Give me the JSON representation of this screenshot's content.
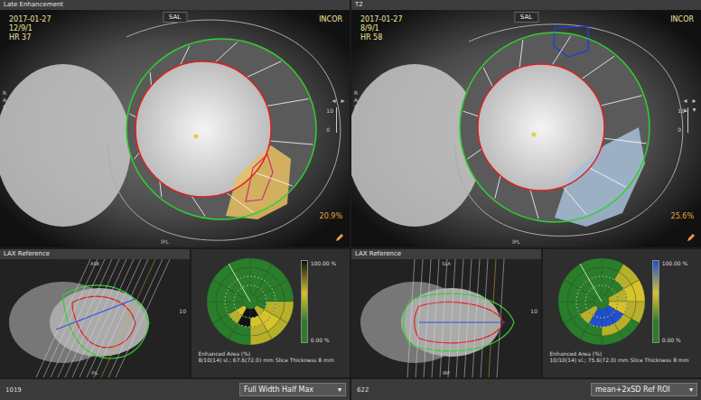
{
  "panels": [
    {
      "title": "Late Enhancement",
      "badge": "SAL",
      "date": "2017-01-27",
      "series": "12/9/1",
      "heart_rate": "HR 37",
      "site": "INCOR",
      "percentage": "20.9%",
      "bottom_label": "IPL",
      "side_letters": [
        "R",
        "A",
        "S"
      ],
      "scale": [
        "10",
        "0"
      ],
      "nav": [
        "◂",
        "▸"
      ],
      "lax": {
        "title": "LAX Reference",
        "top_label": "ASR",
        "bottom_label": "PIL",
        "scale": "10"
      },
      "bullseye": {
        "max": "100.00 %",
        "min": "0.00 %",
        "caption": "Enhanced Area (%)",
        "details": "8/10(14) sl.; 67.6(72.0) mm Slice Thickness 8 mm",
        "top_color": "#111111",
        "rings": [
          [
            0,
            0,
            0,
            30,
            40,
            30,
            0,
            0,
            0,
            0,
            0,
            0
          ],
          [
            0,
            0,
            0,
            40,
            50,
            40,
            0,
            0,
            0,
            0,
            0,
            0
          ],
          [
            0,
            0,
            0,
            35,
            60,
            55,
            90,
            30,
            0,
            0,
            0,
            0
          ],
          [
            0,
            0,
            0,
            0,
            40,
            80,
            95,
            60,
            0,
            0,
            0,
            0
          ]
        ]
      },
      "footer": {
        "number": "1019",
        "method": "Full Width Half Max",
        "glyph": "▾"
      }
    },
    {
      "title": "T2",
      "badge": "SAL",
      "date": "2017-01-27",
      "series": "8/9/1",
      "heart_rate": "HR 58",
      "site": "INCOR",
      "percentage": "25.6%",
      "bottom_label": "IPL",
      "side_letters": [
        "R",
        "A",
        "S"
      ],
      "scale": [
        "10",
        "0"
      ],
      "nav": [
        "◂",
        "▸",
        "▴",
        "▾"
      ],
      "lax": {
        "title": "LAX Reference",
        "top_label": "SLA",
        "bottom_label": "IRP",
        "scale": "10"
      },
      "bullseye": {
        "max": "100.00 %",
        "min": "0.00 %",
        "caption": "Enhanced Area (%)",
        "details": "10/10(14) sl.; 75.6(72.0) mm Slice Thickness 8 mm",
        "top_color": "#1f4fd0",
        "rings": [
          [
            0,
            40,
            50,
            30,
            0,
            0,
            0,
            0,
            0,
            0,
            0,
            0
          ],
          [
            0,
            30,
            45,
            40,
            35,
            30,
            0,
            0,
            0,
            0,
            0,
            0
          ],
          [
            0,
            0,
            40,
            60,
            85,
            90,
            80,
            40,
            0,
            0,
            0,
            0
          ],
          [
            0,
            0,
            30,
            50,
            90,
            95,
            85,
            30,
            0,
            0,
            0,
            0
          ]
        ]
      },
      "footer": {
        "number": "622",
        "method": "mean+2xSD Ref ROI",
        "glyph": "▾"
      }
    }
  ]
}
